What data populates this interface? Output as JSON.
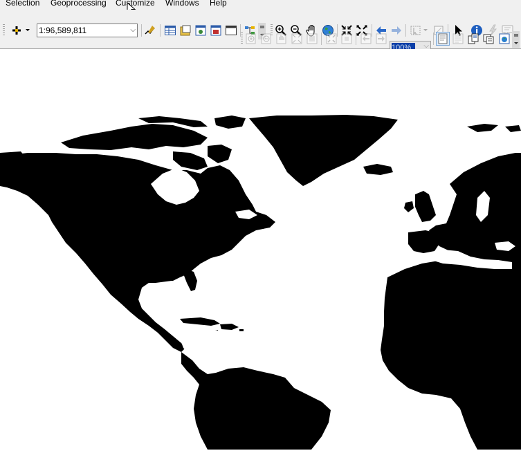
{
  "menu": {
    "items": [
      "Selection",
      "Geoprocessing",
      "Customize",
      "Windows",
      "Help"
    ]
  },
  "toolbar": {
    "scale_value": "1:96,589,811",
    "zoom_value": "100%",
    "tools_row1": [
      "add-data-icon",
      "editor-icon",
      "table-icon",
      "catalog-icon",
      "window-icon",
      "model-icon",
      "layout-icon",
      "tree-icon",
      "zoom-in-icon",
      "zoom-out-icon",
      "pan-icon",
      "globe-icon",
      "fixed-zoom-in-icon",
      "fixed-zoom-out-icon",
      "back-icon",
      "forward-icon",
      "select-features-icon",
      "clear-selection-icon",
      "select-elements-icon",
      "identify-icon",
      "hyperlink-icon",
      "html-popup-icon"
    ],
    "tools_row2": [
      "layout-zoom-in-icon",
      "layout-zoom-out-icon",
      "layout-pan-icon",
      "zoom-whole-page-icon",
      "zoom-100-icon",
      "fixed-zoom-in-layout-icon",
      "fixed-zoom-out-layout-icon",
      "layout-back-icon",
      "layout-forward-icon",
      "toggle-draft-icon",
      "focus-frame-icon",
      "change-layout-icon",
      "data-driven-pages-icon",
      "layout-options-icon"
    ]
  },
  "map": {
    "land_color": "#000000",
    "water_color": "#ffffff"
  }
}
